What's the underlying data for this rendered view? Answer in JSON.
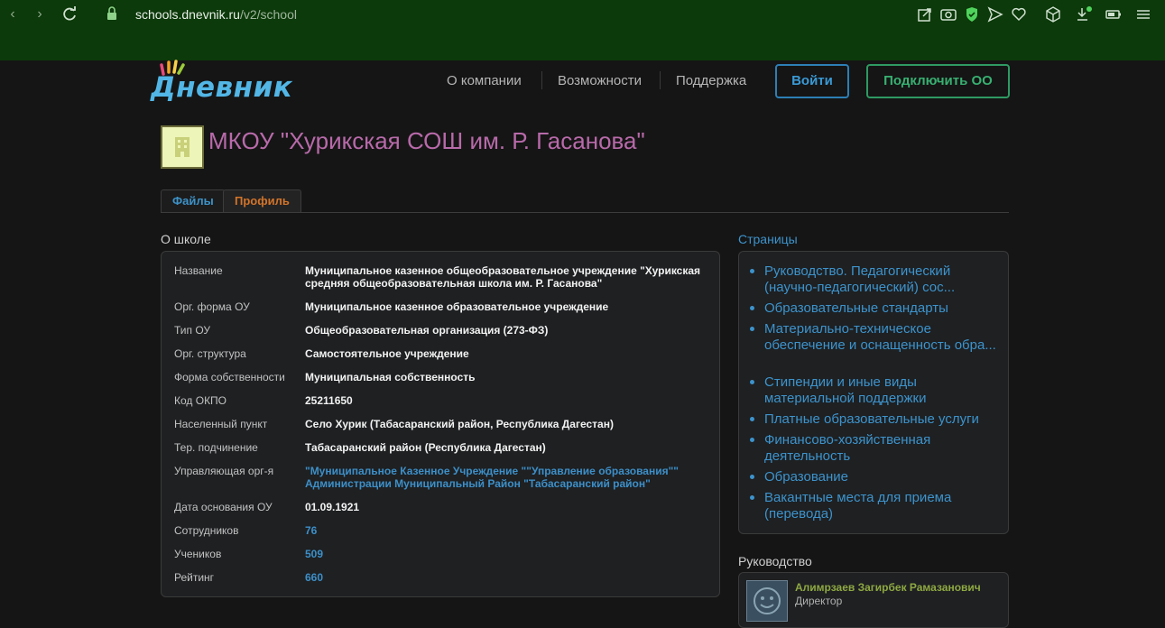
{
  "browser": {
    "url_host": "schools.dnevnik.ru",
    "url_path": "/v2/school"
  },
  "header": {
    "logo_text": "Дневник",
    "nav": [
      "О компании",
      "Возможности",
      "Поддержка"
    ],
    "login_label": "Войти",
    "connect_label": "Подключить ОО"
  },
  "school": {
    "title": "МКОУ \"Хурикская СОШ им. Р. Гасанова\""
  },
  "tabs": [
    {
      "label": "Файлы",
      "active": false
    },
    {
      "label": "Профиль",
      "active": true
    }
  ],
  "about": {
    "heading": "О школе",
    "rows": [
      {
        "label": "Название",
        "value": "Муниципальное казенное общеобразовательное учреждение \"Хурикская средняя общеобразовательная школа им. Р. Гасанова\""
      },
      {
        "label": "Орг. форма ОУ",
        "value": "Муниципальное казенное образовательное учреждение"
      },
      {
        "label": "Тип ОУ",
        "value": "Общеобразовательная организация (273-ФЗ)"
      },
      {
        "label": "Орг. структура",
        "value": "Самостоятельное учреждение"
      },
      {
        "label": "Форма собственности",
        "value": "Муниципальная собственность"
      },
      {
        "label": "Код ОКПО",
        "value": "25211650"
      },
      {
        "label": "Населенный пункт",
        "value": "Село Хурик (Табасаранский район, Республика Дагестан)"
      },
      {
        "label": "Тер. подчинение",
        "value": "Табасаранский район (Республика Дагестан)"
      },
      {
        "label": "Управляющая орг-я",
        "value": "\"Муниципальное Казенное Учреждение \"\"Управление образования\"\" Администрации Муниципальный Район \"Табасаранский район\""
      },
      {
        "label": "Дата основания ОУ",
        "value": "01.09.1921"
      },
      {
        "label": "Сотрудников",
        "value": "76"
      },
      {
        "label": "Учеников",
        "value": "509"
      },
      {
        "label": "Рейтинг",
        "value": "660"
      }
    ]
  },
  "pages": {
    "heading": "Страницы",
    "items": [
      "Руководство. Педагогический (научно-педагогический) сос...",
      "Образовательные стандарты",
      "Материально-техническое обеспечение и оснащенность обра...",
      "Стипендии и иные виды материальной поддержки",
      "Платные образовательные услуги",
      "Финансово-хозяйственная деятельность",
      "Образование",
      "Вакантные места для приема (перевода)"
    ]
  },
  "leadership": {
    "heading": "Руководство",
    "name": "Алимрзаев Загирбек Рамазанович",
    "role": "Директор"
  },
  "colors": {
    "browser_bar": "#0c3a0a",
    "page_bg": "#151515",
    "link": "#3d93cc",
    "title": "#b86aaa",
    "active_tab": "#d2742a",
    "connect": "#38b071"
  }
}
